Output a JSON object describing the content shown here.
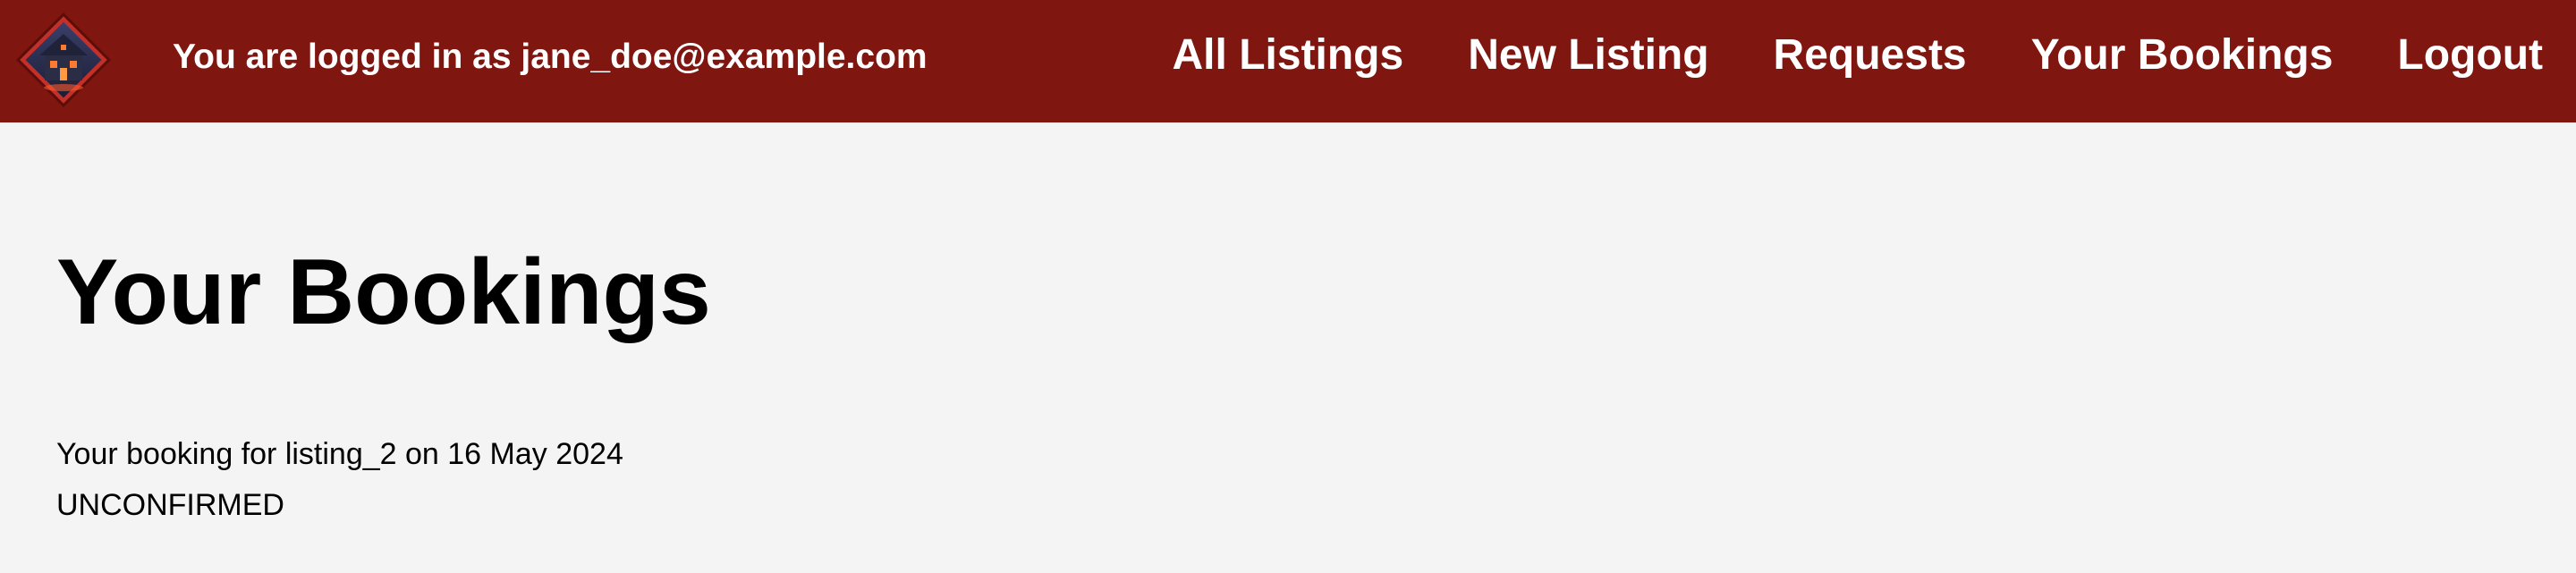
{
  "header": {
    "logo_icon": "haunted-house-logo-icon",
    "login_status": "You are logged in as jane_doe@example.com",
    "nav": [
      {
        "label": "All Listings"
      },
      {
        "label": "New Listing"
      },
      {
        "label": "Requests"
      },
      {
        "label": "Your Bookings"
      },
      {
        "label": "Logout"
      }
    ],
    "colors": {
      "background": "#7f1610",
      "text": "#ffffff"
    }
  },
  "main": {
    "title": "Your Bookings",
    "bookings": [
      {
        "description": "Your booking for listing_2 on 16 May 2024",
        "status": "UNCONFIRMED"
      }
    ]
  }
}
